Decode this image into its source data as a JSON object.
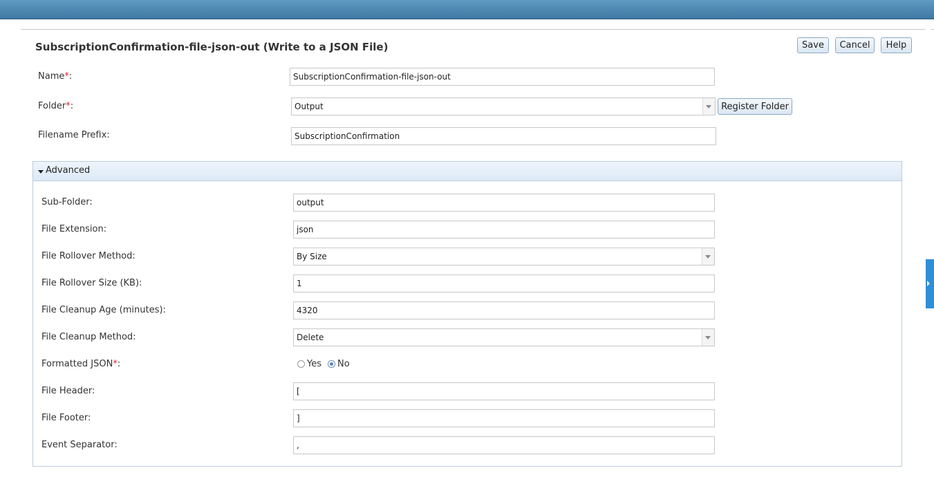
{
  "header": {
    "title": "SubscriptionConfirmation-file-json-out (Write to a JSON File)",
    "buttons": {
      "save": "Save",
      "cancel": "Cancel",
      "help": "Help"
    }
  },
  "form": {
    "name": {
      "label": "Name",
      "required_mark": "*",
      "suffix": ":",
      "value": "SubscriptionConfirmation-file-json-out"
    },
    "folder": {
      "label": "Folder",
      "required_mark": "*",
      "suffix": ":",
      "value": "Output",
      "register_button": "Register Folder"
    },
    "filename_prefix": {
      "label": "Filename Prefix:",
      "value": "SubscriptionConfirmation"
    }
  },
  "advanced": {
    "title": "Advanced",
    "sub_folder": {
      "label": "Sub-Folder:",
      "value": "output"
    },
    "file_extension": {
      "label": "File Extension:",
      "value": "json"
    },
    "rollover_method": {
      "label": "File Rollover Method:",
      "value": "By Size"
    },
    "rollover_size": {
      "label": "File Rollover Size (KB):",
      "value": "1"
    },
    "cleanup_age": {
      "label": "File Cleanup Age (minutes):",
      "value": "4320"
    },
    "cleanup_method": {
      "label": "File Cleanup Method:",
      "value": "Delete"
    },
    "formatted_json": {
      "label": "Formatted JSON",
      "required_mark": "*",
      "suffix": ":",
      "options": [
        "Yes",
        "No"
      ],
      "selected": "No"
    },
    "file_header": {
      "label": "File Header:",
      "value": "["
    },
    "file_footer": {
      "label": "File Footer:",
      "value": "]"
    },
    "event_separator": {
      "label": "Event Separator:",
      "value": ","
    }
  },
  "colors": {
    "topbar": "#4a87b1",
    "required": "#d9262b",
    "panel_border": "#b9cddd",
    "side_tab": "#2f8fd6"
  }
}
